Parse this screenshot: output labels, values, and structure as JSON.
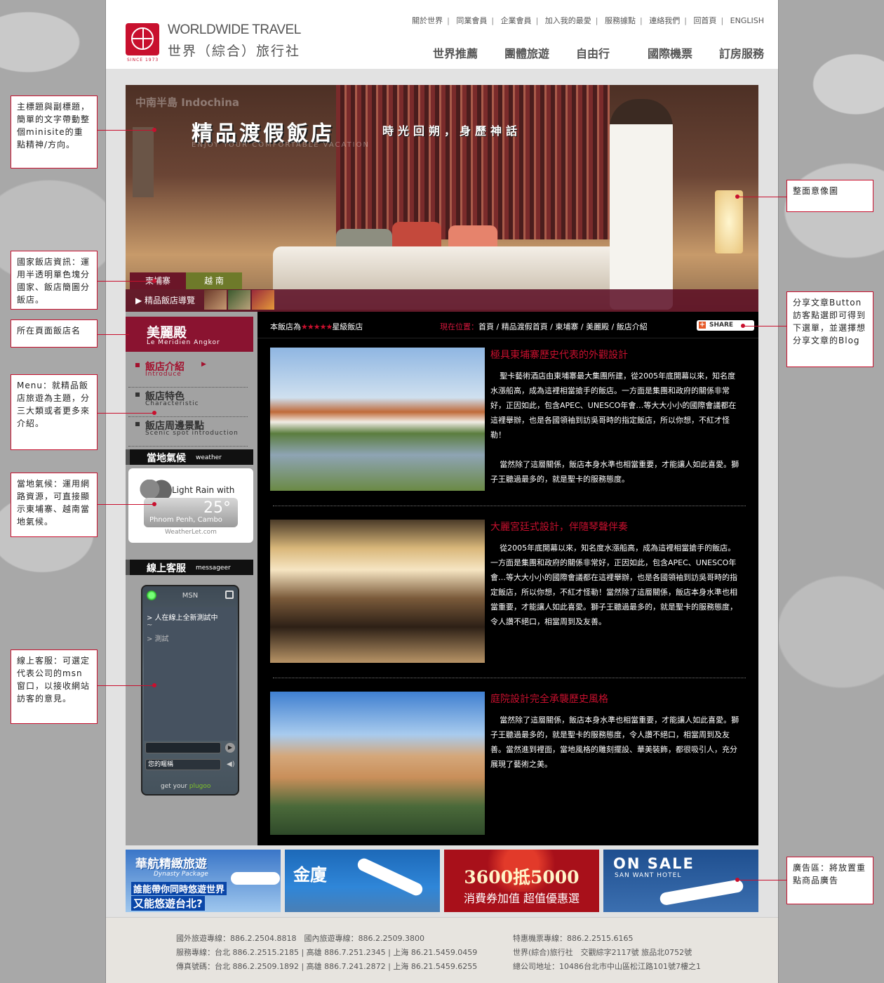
{
  "header": {
    "logo_en": "WORLDWIDE TRAVEL",
    "logo_zh": "世界（綜合）旅行社",
    "logo_since": "SINCE 1973",
    "top_links": [
      "關於世界",
      "同業會員",
      "企業會員",
      "加入我的最愛",
      "服務據點",
      "連絡我們",
      "回首頁",
      "ENGLISH"
    ],
    "main_nav": [
      "世界推薦",
      "團體旅遊",
      "自由行",
      "國際機票",
      "訂房服務"
    ]
  },
  "hero": {
    "region": "中南半島 Indochina",
    "title": "精品渡假飯店",
    "slogan": "時光回朔，身歷神話",
    "subtitle": "ENJOY YOUR COMFORTABLE VACATION",
    "tabs": [
      "柬埔寨",
      "越 南"
    ],
    "guide_label": "▶  精品飯店導覽"
  },
  "sidebar": {
    "hotel_zh": "美麗殿",
    "hotel_en": "Le Meridien Angkor",
    "menu": [
      {
        "zh": "飯店介紹",
        "en": "Introduce"
      },
      {
        "zh": "飯店特色",
        "en": "Characteristic"
      },
      {
        "zh": "飯店周邊景點",
        "en": "Scenic spot introduction"
      }
    ],
    "weather_head_zh": "當地氣候",
    "weather_head_en": "weather",
    "weather_desc": "Light Rain with",
    "weather_temp": "25°",
    "weather_city": "Phnom Penh, Cambo",
    "weather_credit": "WeatherLet.com",
    "msg_head_zh": "線上客服",
    "msg_head_en": "messageer",
    "msn_title": "MSN",
    "msn_line1": "> 人在線上全新測試中",
    "msn_line2": "~",
    "msn_line3": "> 測試",
    "msn_name": "您的暱稱",
    "msn_brand_a": "get your ",
    "msn_brand_b": "plugoo"
  },
  "content": {
    "rating_prefix": "本飯店為",
    "rating_stars": "★★★★★",
    "rating_suffix": "星級飯店",
    "crumb_label": "現在位置：",
    "crumb": "首頁 / 精品渡假首頁 / 柬埔寨 / 美麗殿 / 飯店介紹",
    "share": "SHARE",
    "articles": [
      {
        "title": "極具東埔寨歷史代表的外觀設計",
        "body": "聖卡藝術酒店由東埔寨最大集團所建，從2005年底開幕以來，知名度水漲船高，成為這裡相當搶手的飯店。一方面是集團和政府的關係非常好，正因如此，包含APEC、UNESCO年會…等大大小小的國際會議都在這裡舉辦，也是各國領袖到訪吳哥時的指定飯店，所以你想，不紅才怪勒！",
        "body2": "當然除了這層關係，飯店本身水準也相當重要，才能讓人如此喜愛。獅子王聽過最多的，就是聖卡的服務態度。"
      },
      {
        "title": "大麗宮廷式設計，伴隨琴聲伴奏",
        "body": "從2005年底開幕以來，知名度水漲船高，成為這裡相當搶手的飯店。一方面是集團和政府的關係非常好，正因如此，包含APEC、UNESCO年會…等大大小小的國際會議都在這裡舉辦，也是各國領袖到訪吳哥時的指定飯店，所以你想，不紅才怪勒！當然除了這層關係，飯店本身水準也相當重要，才能讓人如此喜愛。獅子王聽過最多的，就是聖卡的服務態度，令人讚不絕口，相當周到及友善。"
      },
      {
        "title": "庭院設計完全承襲歷史風格",
        "body": "當然除了這層關係，飯店本身水準也相當重要，才能讓人如此喜愛。獅子王聽過最多的，就是聖卡的服務態度，令人讚不絕口，相當周到及友善。當然進到裡面，當地風格的雕刻擺設、華美裝飾，都很吸引人，充分展現了藝術之美。"
      }
    ]
  },
  "ads": {
    "ad1_title": "華航精緻旅遊",
    "ad1_sub": "Dynasty Package",
    "ad1_line1": "誰能帶你同時悠遊世界",
    "ad1_line2": "又能悠遊台北?",
    "ad2_title": "金廈",
    "ad3_title": "3600抵5000",
    "ad3_sub": "消費券加值 超值優惠選",
    "ad4_title": "ON SALE",
    "ad4_sub": "SAN WANT HOTEL"
  },
  "footer": {
    "left": [
      "國外旅遊專線：886.2.2504.8818　國內旅遊專線：886.2.2509.3800",
      "服務專線：台北 886.2.2515.2185 | 高雄 886.7.251.2345 | 上海 86.21.5459.0459",
      "傳真號碼：台北 886.2.2509.1892 | 高雄 886.7.241.2872 | 上海 86.21.5459.6255"
    ],
    "right": [
      "特惠機票專線：886.2.2515.6165",
      "世界(綜合)旅行社　交觀綜字2117號 旅品北0752號",
      "總公司地址：10486台北市中山區松江路101號7樓之1"
    ]
  },
  "annotations": {
    "n1": "主標題與副標題，簡單的文字帶動整個minisite的重點精神/方向。",
    "n2": "國家飯店資訊：運用半透明單色塊分國家、飯店簡圖分飯店。",
    "n3": "所在頁面飯店名",
    "n4": "Menu：就精品飯店旅遊為主題，分三大類或者更多來介紹。",
    "n5": "當地氣候：運用網路資源，可直接顯示東埔寨、越南當地氣候。",
    "n6": "線上客服：可選定代表公司的msn窗口，以接收網站訪客的意見。",
    "n7": "整面意像圖",
    "n8": "分享文章Button訪客點選即可得到下選單，並選擇想分享文章的Blog",
    "n9": "廣告區：將放置重點商品廣告"
  }
}
